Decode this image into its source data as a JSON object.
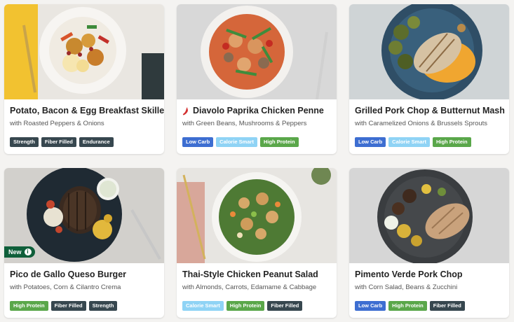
{
  "tag_colors": {
    "Strength": "#37474f",
    "Fiber Filled": "#37474f",
    "Endurance": "#37474f",
    "Low Carb": "#3d6ed1",
    "Calorie Smart": "#8fd3f5",
    "High Protein": "#5aa74a"
  },
  "cards": [
    {
      "title": "Potato, Bacon & Egg Breakfast Skillet",
      "subtitle": "with Roasted Peppers & Onions",
      "tags": [
        "Strength",
        "Fiber Filled",
        "Endurance"
      ],
      "spicy": false,
      "badge": null
    },
    {
      "title": "Diavolo Paprika Chicken Penne",
      "subtitle": "with Green Beans, Mushrooms & Peppers",
      "tags": [
        "Low Carb",
        "Calorie Smart",
        "High Protein"
      ],
      "spicy": true,
      "badge": null
    },
    {
      "title": "Grilled Pork Chop & Butternut Mash",
      "subtitle": "with Caramelized Onions & Brussels Sprouts",
      "tags": [
        "Low Carb",
        "Calorie Smart",
        "High Protein"
      ],
      "spicy": false,
      "badge": null
    },
    {
      "title": "Pico de Gallo Queso Burger",
      "subtitle": "with Potatoes, Corn & Cilantro Crema",
      "tags": [
        "High Protein",
        "Fiber Filled",
        "Strength"
      ],
      "spicy": false,
      "badge": "New"
    },
    {
      "title": "Thai-Style Chicken Peanut Salad",
      "subtitle": "with Almonds, Carrots, Edamame & Cabbage",
      "tags": [
        "Calorie Smart",
        "High Protein",
        "Fiber Filled"
      ],
      "spicy": false,
      "badge": null
    },
    {
      "title": "Pimento Verde Pork Chop",
      "subtitle": "with Corn Salad, Beans & Zucchini",
      "tags": [
        "Low Carb",
        "High Protein",
        "Fiber Filled"
      ],
      "spicy": false,
      "badge": null
    }
  ]
}
